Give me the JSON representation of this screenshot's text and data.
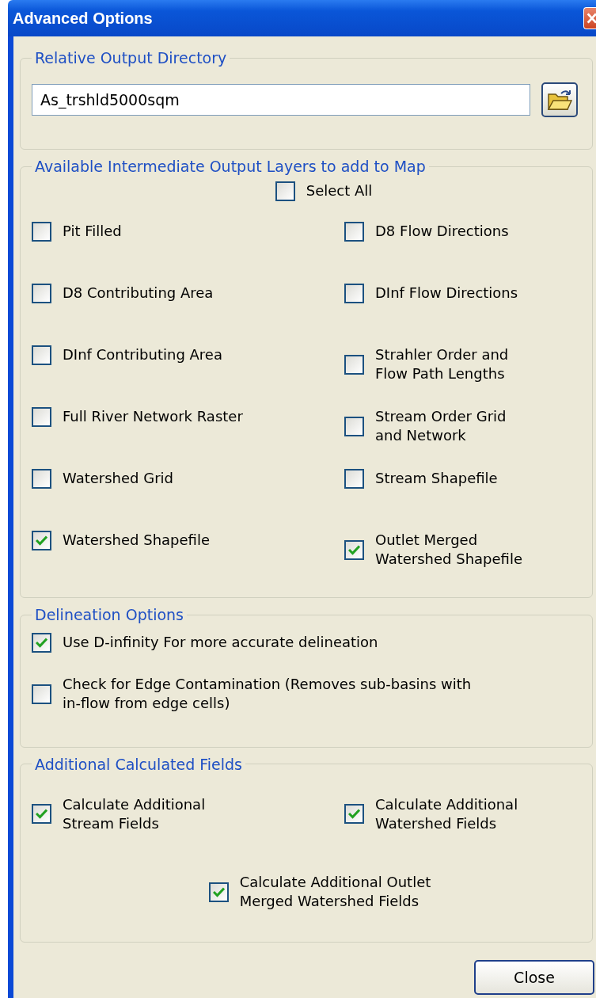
{
  "window": {
    "title": "Advanced Options"
  },
  "output_directory": {
    "legend": "Relative Output Directory",
    "value": "As_trshld5000sqm"
  },
  "layers": {
    "legend": "Available Intermediate Output Layers to add to Map",
    "select_all": {
      "label": "Select All",
      "checked": false
    },
    "items": [
      {
        "label": "Pit Filled",
        "checked": false
      },
      {
        "label": "D8 Flow Directions",
        "checked": false
      },
      {
        "label": "D8 Contributing Area",
        "checked": false
      },
      {
        "label": "DInf Flow Directions",
        "checked": false
      },
      {
        "label": "DInf Contributing Area",
        "checked": false
      },
      {
        "label": "Strahler Order and\nFlow Path Lengths",
        "checked": false
      },
      {
        "label": "Full River Network Raster",
        "checked": false
      },
      {
        "label": "Stream Order Grid\nand Network",
        "checked": false
      },
      {
        "label": "Watershed Grid",
        "checked": false
      },
      {
        "label": "Stream Shapefile",
        "checked": false
      },
      {
        "label": "Watershed Shapefile",
        "checked": true
      },
      {
        "label": "Outlet Merged\nWatershed Shapefile",
        "checked": true
      }
    ]
  },
  "delineation": {
    "legend": "Delineation Options",
    "options": [
      {
        "label": "Use D-infinity For more accurate delineation",
        "checked": true
      },
      {
        "label": "Check for Edge Contamination (Removes sub-basins with\nin-flow from edge cells)",
        "checked": false
      }
    ]
  },
  "calculated_fields": {
    "legend": "Additional Calculated Fields",
    "options": [
      {
        "label": "Calculate Additional\nStream Fields",
        "checked": true
      },
      {
        "label": "Calculate Additional\nWatershed Fields",
        "checked": true
      },
      {
        "label": "Calculate Additional Outlet\nMerged Watershed Fields",
        "checked": true
      }
    ]
  },
  "buttons": [
    {
      "label": "Close"
    }
  ]
}
